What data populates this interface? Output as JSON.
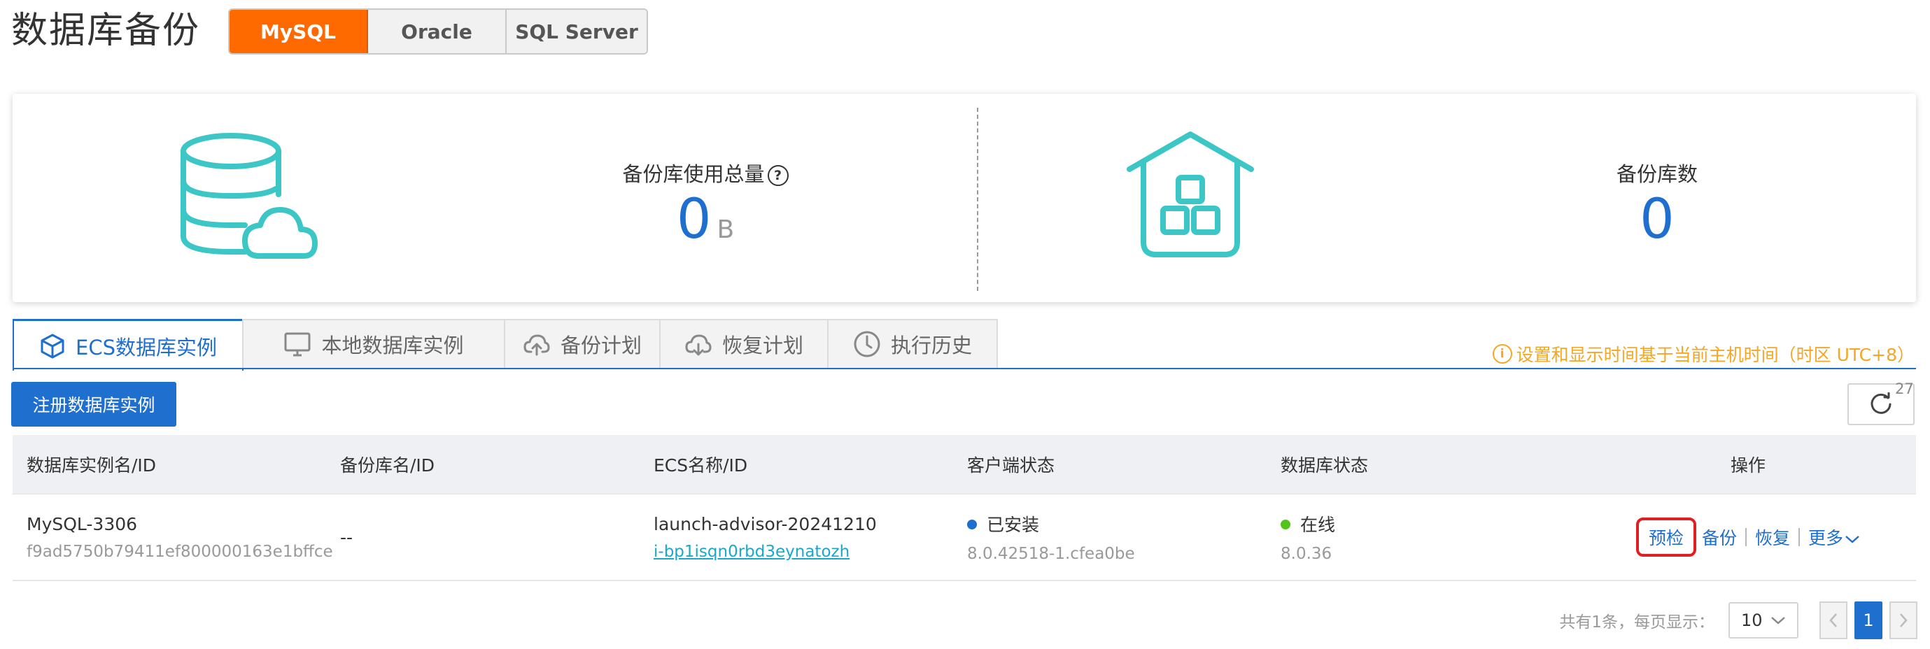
{
  "page": {
    "title": "数据库备份",
    "engines": [
      "MySQL",
      "Oracle",
      "SQL Server"
    ],
    "active_engine": "MySQL"
  },
  "stats": {
    "usage_label": "备份库使用总量",
    "usage_help": "?",
    "usage_value": "0",
    "usage_unit": "B",
    "count_label": "备份库数",
    "count_value": "0"
  },
  "tabs": [
    {
      "label": "ECS数据库实例",
      "icon": "cube-icon",
      "active": true
    },
    {
      "label": "本地数据库实例",
      "icon": "monitor-icon",
      "active": false
    },
    {
      "label": "备份计划",
      "icon": "cloud-upload-icon",
      "active": false
    },
    {
      "label": "恢复计划",
      "icon": "cloud-download-icon",
      "active": false
    },
    {
      "label": "执行历史",
      "icon": "clock-icon",
      "active": false
    }
  ],
  "timezone_note": "设置和显示时间基于当前主机时间（时区 UTC+8）",
  "toolbar": {
    "register_label": "注册数据库实例",
    "refresh_count": "27"
  },
  "table": {
    "columns": [
      "数据库实例名/ID",
      "备份库名/ID",
      "ECS名称/ID",
      "客户端状态",
      "数据库状态",
      "操作"
    ],
    "rows": [
      {
        "instance_name": "MySQL-3306",
        "instance_id": "f9ad5750b79411ef800000163e1bffce",
        "backup_db": "--",
        "ecs_name": "launch-advisor-20241210",
        "ecs_id": "i-bp1isqn0rbd3eynatozh",
        "client_status": "已安装",
        "client_version": "8.0.42518-1.cfea0be",
        "db_status": "在线",
        "db_version": "8.0.36",
        "actions": {
          "precheck": "预检",
          "backup": "备份",
          "restore": "恢复",
          "more": "更多"
        }
      }
    ]
  },
  "pagination": {
    "summary": "共有1条，每页显示：",
    "page_size": "10",
    "current_page": "1"
  },
  "colors": {
    "accent": "#1f6fcf",
    "brand_orange": "#ff6a00",
    "teal_icon": "#3cc6c6",
    "status_installed": "#1f6fcf",
    "status_online": "#52c41a",
    "warning_note": "#f5a623",
    "highlight": "#e02020"
  }
}
